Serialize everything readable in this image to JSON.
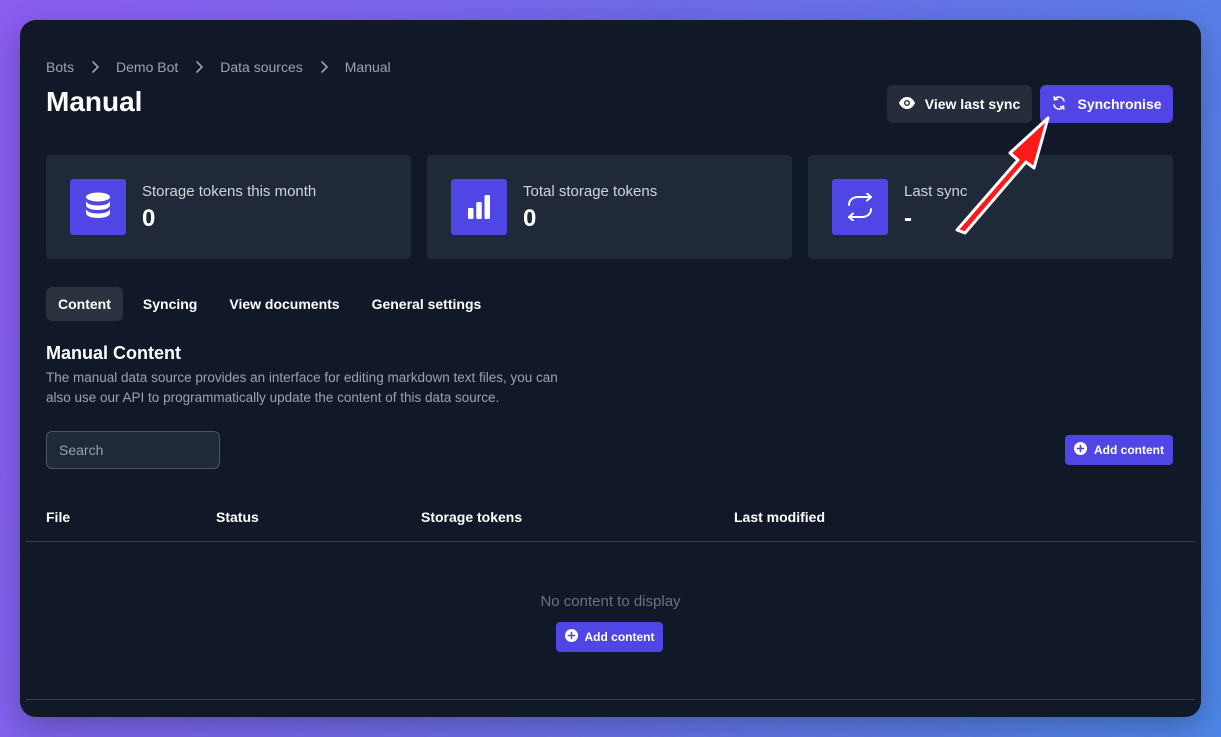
{
  "breadcrumb": [
    "Bots",
    "Demo Bot",
    "Data sources",
    "Manual"
  ],
  "page_title": "Manual",
  "header_actions": {
    "view_last_sync": "View last sync",
    "synchronise": "Synchronise"
  },
  "stats": [
    {
      "label": "Storage tokens this month",
      "value": "0",
      "icon": "database-icon"
    },
    {
      "label": "Total storage tokens",
      "value": "0",
      "icon": "bar-chart-icon"
    },
    {
      "label": "Last sync",
      "value": "-",
      "icon": "sync-icon"
    }
  ],
  "tabs": [
    "Content",
    "Syncing",
    "View documents",
    "General settings"
  ],
  "active_tab": "Content",
  "section": {
    "title": "Manual Content",
    "description": "The manual data source provides an interface for editing markdown text files, you can also use our API to programmatically update the content of this data source."
  },
  "search": {
    "placeholder": "Search",
    "value": ""
  },
  "add_content_label": "Add content",
  "table": {
    "columns": [
      "File",
      "Status",
      "Storage tokens",
      "Last modified"
    ],
    "rows": [],
    "empty_text": "No content to display"
  },
  "colors": {
    "accent": "#5046e5",
    "background": "#111827",
    "card": "#1f2937",
    "annotation_arrow": "#ff1a1a"
  }
}
